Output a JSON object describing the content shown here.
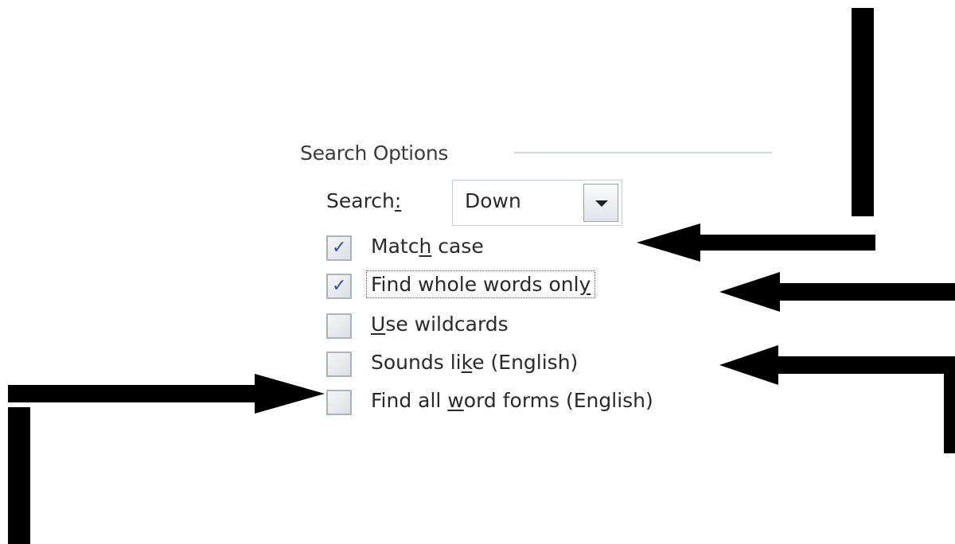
{
  "section": {
    "title": "Search Options"
  },
  "search": {
    "label_pre": "Search",
    "label_mnemonic": ":",
    "value": "Down"
  },
  "options": [
    {
      "pre": "Matc",
      "mn": "h",
      "post": " case",
      "checked": true
    },
    {
      "pre": "Find whole words onl",
      "mn": "y",
      "post": "",
      "checked": true,
      "focused": true
    },
    {
      "pre": "",
      "mn": "U",
      "post": "se wildcards",
      "checked": false
    },
    {
      "pre": "Sounds li",
      "mn": "k",
      "post": "e (English)",
      "checked": false
    },
    {
      "pre": "Find all ",
      "mn": "w",
      "post": "ord forms (English)",
      "checked": false
    }
  ],
  "annotations": {
    "arrow_color": "#000000",
    "check_glyph": "✓"
  }
}
